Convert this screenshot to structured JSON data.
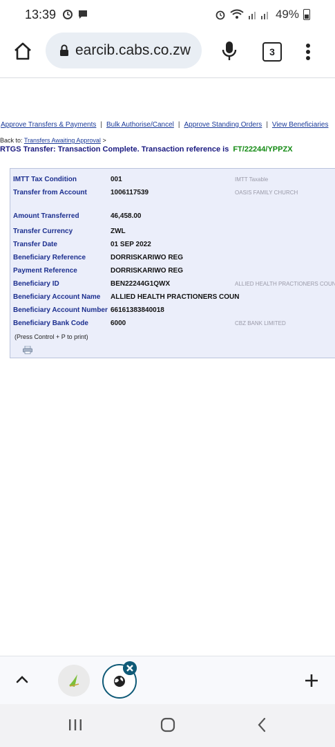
{
  "status_bar": {
    "time": "13:39",
    "battery_percent": "49%"
  },
  "browser": {
    "url": "earcib.cabs.co.zw",
    "tab_count": "3"
  },
  "nav_links": [
    "Approve Transfers & Payments",
    "Bulk Authorise/Cancel",
    "Approve Standing Orders",
    "View Beneficiaries"
  ],
  "back": {
    "prefix": "Back to:",
    "link": "Transfers Awaiting Approval",
    "suffix": ">"
  },
  "message": {
    "text": "RTGS Transfer: Transaction Complete. Transaction reference is",
    "reference": "FT/22244/YPPZX"
  },
  "details": [
    {
      "label": "IMTT Tax Condition",
      "value": "001",
      "extra": "IMTT Taxable"
    },
    {
      "label": "Transfer from Account",
      "value": "1006117539",
      "extra": "OASIS FAMILY CHURCH"
    },
    {
      "label": "Amount Transferred",
      "value": "46,458.00",
      "extra": ""
    },
    {
      "label": "Transfer Currency",
      "value": "ZWL",
      "extra": ""
    },
    {
      "label": "Transfer Date",
      "value": "01 SEP 2022",
      "extra": ""
    },
    {
      "label": "Beneficiary Reference",
      "value": "DORRISKARIWO REG",
      "extra": ""
    },
    {
      "label": "Payment Reference",
      "value": "DORRISKARIWO REG",
      "extra": ""
    },
    {
      "label": "Beneficiary ID",
      "value": "BEN22244G1QWX",
      "extra": "ALLIED HEALTH PRACTIONERS COUN"
    },
    {
      "label": "Beneficiary Account Name",
      "value": "ALLIED HEALTH PRACTIONERS COUN",
      "extra": ""
    },
    {
      "label": "Beneficiary Account Number",
      "value": "66161383840018",
      "extra": ""
    },
    {
      "label": "Beneficiary Bank Code",
      "value": "6000",
      "extra": "CBZ BANK LIMITED"
    }
  ],
  "print_note": "(Press Control + P to print)",
  "icons": {
    "home": "home-icon",
    "lock": "lock-icon",
    "mic": "mic-icon",
    "menu": "more-vert-icon",
    "printer": "printer-icon",
    "up": "chevron-up-icon",
    "plus": "plus-icon"
  },
  "colors": {
    "link": "#1a3a99",
    "reference": "#128a12",
    "panel_bg": "#ebeefa",
    "accent_tab": "#0f5a77"
  }
}
